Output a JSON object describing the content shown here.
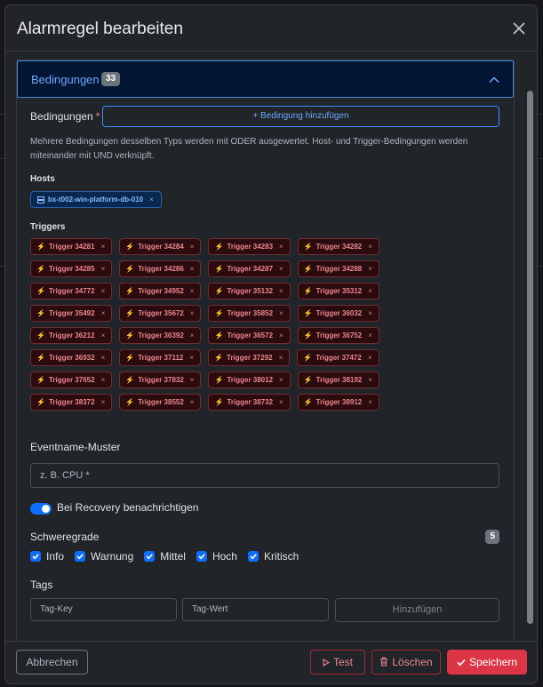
{
  "modal": {
    "title": "Alarmregel bearbeiten"
  },
  "accordion": {
    "title": "Bedingungen",
    "count": "33"
  },
  "conditions": {
    "label": "Bedingungen",
    "required_marker": "*",
    "add_button": "+ Bedingung hinzufügen",
    "help_text": "Mehrere Bedingungen desselben Typs werden mit ODER ausgewertet. Host- und Trigger-Bedingungen werden miteinander mit UND verknüpft."
  },
  "hosts": {
    "label": "Hosts",
    "items": [
      "bx-t002-win-platform-db-010"
    ]
  },
  "triggers": {
    "label": "Triggers",
    "rows": [
      [
        "Trigger 34281",
        "Trigger 34284",
        "Trigger 34283",
        "Trigger 34282"
      ],
      [
        "Trigger 34285",
        "Trigger 34286",
        "Trigger 34287",
        "Trigger 34288"
      ],
      [
        "Trigger 34772",
        "Trigger 34952",
        "Trigger 35132",
        "Trigger 35312"
      ],
      [
        "Trigger 35492",
        "Trigger 35672",
        "Trigger 35852",
        "Trigger 36032"
      ],
      [
        "Trigger 36212",
        "Trigger 36392",
        "Trigger 36572",
        "Trigger 36752"
      ],
      [
        "Trigger 36932",
        "Trigger 37112",
        "Trigger 37292",
        "Trigger 37472"
      ],
      [
        "Trigger 37652",
        "Trigger 37832",
        "Trigger 38012",
        "Trigger 38192"
      ],
      [
        "Trigger 38372",
        "Trigger 38552",
        "Trigger 38732",
        "Trigger 38912"
      ]
    ],
    "remove_glyph": "×"
  },
  "event_pattern": {
    "label": "Eventname-Muster",
    "placeholder": "z. B. CPU *"
  },
  "recovery": {
    "label": "Bei Recovery benachrichtigen",
    "enabled": true
  },
  "severity": {
    "label": "Schweregrade",
    "count": "5",
    "options": [
      {
        "label": "Info",
        "checked": true
      },
      {
        "label": "Warnung",
        "checked": true
      },
      {
        "label": "Mittel",
        "checked": true
      },
      {
        "label": "Hoch",
        "checked": true
      },
      {
        "label": "Kritisch",
        "checked": true
      }
    ]
  },
  "tags": {
    "label": "Tags",
    "key_placeholder": "Tag-Key",
    "value_placeholder": "Tag-Wert",
    "add_button": "Hinzufügen"
  },
  "footer": {
    "cancel": "Abbrechen",
    "test": "Test",
    "delete": "Löschen",
    "save": "Speichern"
  },
  "colors": {
    "accent": "#0d6efd",
    "danger": "#dc3545",
    "chip_danger_text": "#ea868f",
    "chip_info_text": "#8bb8ff"
  }
}
